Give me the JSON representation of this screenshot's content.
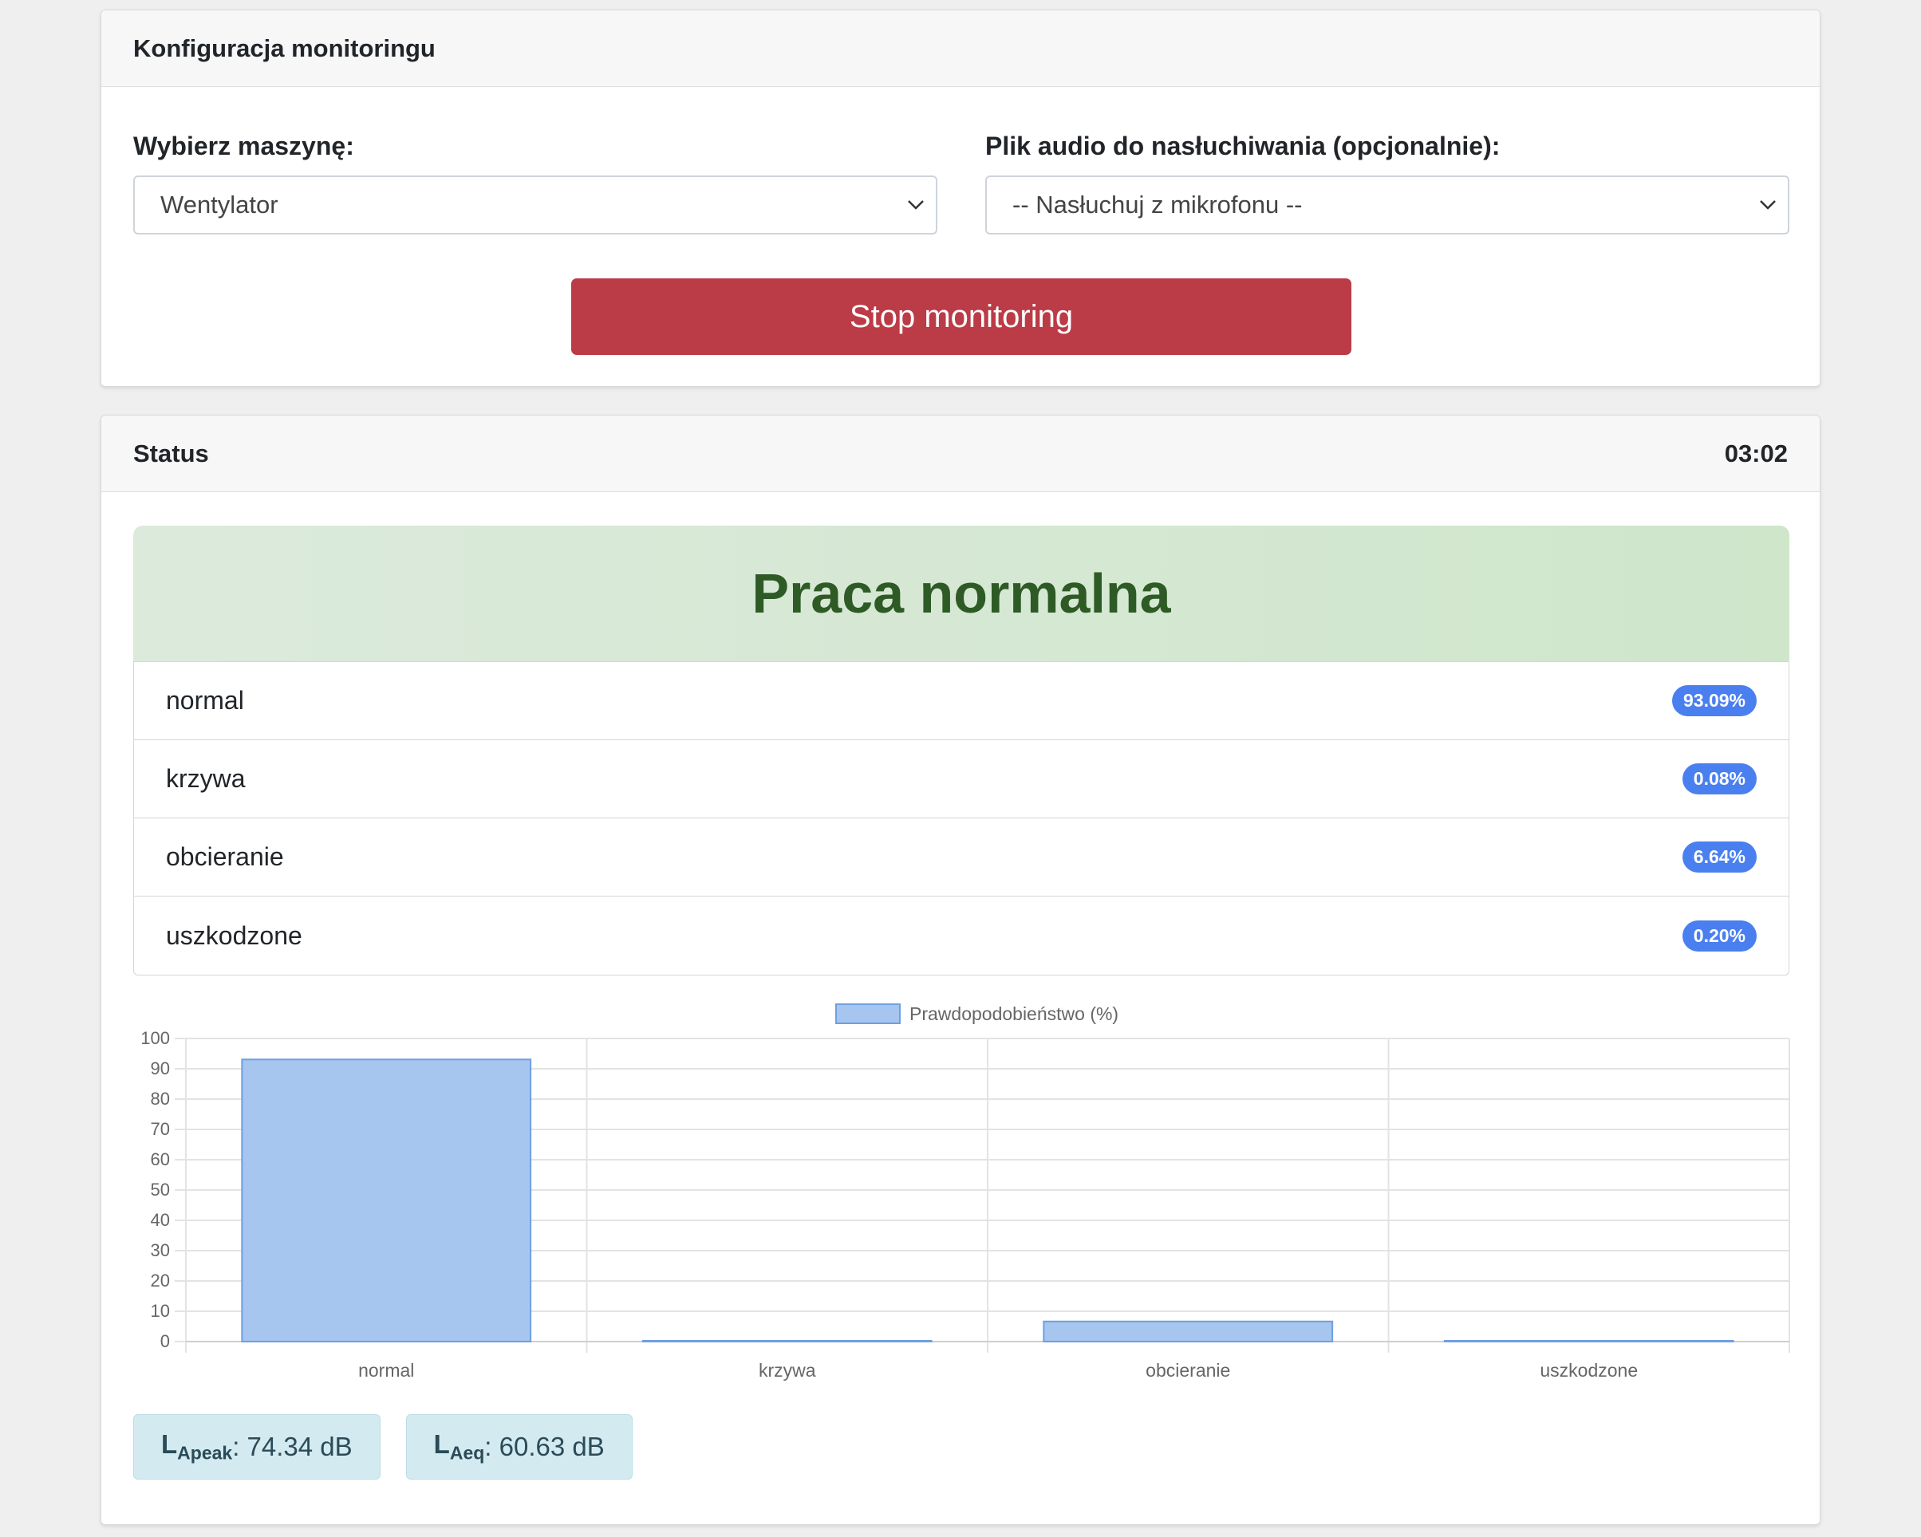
{
  "config": {
    "title": "Konfiguracja monitoringu",
    "machine_label": "Wybierz maszynę:",
    "machine_value": "Wentylator",
    "audio_label": "Plik audio do nasłuchiwania (opcjonalnie):",
    "audio_value": "-- Nasłuchuj z mikrofonu --",
    "stop_label": "Stop monitoring"
  },
  "status": {
    "title": "Status",
    "timer": "03:02",
    "state_text": "Praca normalna",
    "classes": [
      {
        "name": "normal",
        "percent": "93.09%"
      },
      {
        "name": "krzywa",
        "percent": "0.08%"
      },
      {
        "name": "obcieranie",
        "percent": "6.64%"
      },
      {
        "name": "uszkodzone",
        "percent": "0.20%"
      }
    ],
    "meters": {
      "peak_L": "L",
      "peak_sub": "Apeak",
      "peak_value": ": 74.34 dB",
      "eq_L": "L",
      "eq_sub": "Aeq",
      "eq_value": ": 60.63 dB"
    }
  },
  "colors": {
    "stop_button": "#bb3b47",
    "badge": "#4a7ff0",
    "bar_fill": "#a6c5ef",
    "bar_stroke": "#6f9fe0",
    "alert_text": "#2e5a26"
  },
  "chart_data": {
    "type": "bar",
    "categories": [
      "normal",
      "krzywa",
      "obcieranie",
      "uszkodzone"
    ],
    "series": [
      {
        "name": "Prawdopodobieństwo (%)",
        "values": [
          93.09,
          0.08,
          6.64,
          0.2
        ]
      }
    ],
    "yticks": [
      0,
      10,
      20,
      30,
      40,
      50,
      60,
      70,
      80,
      90,
      100
    ],
    "ylim": [
      0,
      100
    ],
    "grid": true,
    "legend": "top-center"
  }
}
